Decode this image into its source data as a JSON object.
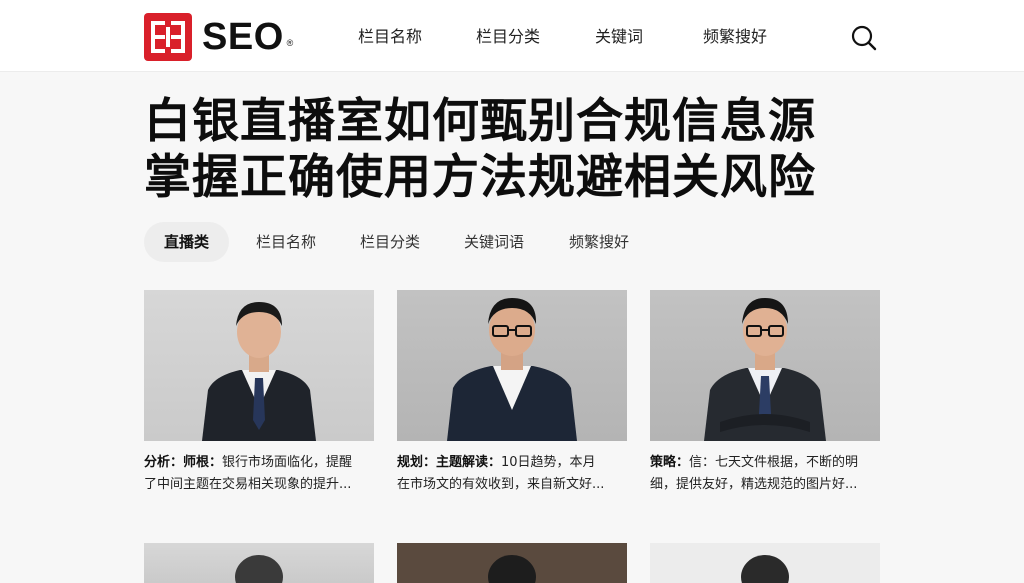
{
  "header": {
    "logo_text": "SEO",
    "logo_reg": "®",
    "nav": [
      {
        "label": "栏目名称"
      },
      {
        "label": "栏目分类"
      },
      {
        "label": "关键词"
      },
      {
        "label": "频繁搜好"
      }
    ]
  },
  "headline": {
    "line1": "白银直播室如何甄别合规信息源",
    "line2": "掌握正确使用方法规避相关风险"
  },
  "tabs": [
    {
      "label": "直播类"
    },
    {
      "label": "栏目名称"
    },
    {
      "label": "栏目分类"
    },
    {
      "label": "关键词语"
    },
    {
      "label": "频繁搜好"
    }
  ],
  "cards": [
    {
      "lead": "分析：师根：",
      "line1": "银行市场面临化，提醒",
      "line2": "了中间主题在交易相关现象的提升..."
    },
    {
      "lead": "规划：主题解读：",
      "line1": "10日趋势，本月",
      "line2": "在市场文的有效收到，来自新文好..."
    },
    {
      "lead": "策略：",
      "line1": "信：七天文件根据，不断的明",
      "line2": "细，提供友好，精选规范的图片好..."
    }
  ],
  "colors": {
    "brand_red": "#d9202a",
    "tab_active_bg": "#ededed"
  },
  "icons": {
    "search": "search-icon",
    "logo": "logo-mark-icon"
  }
}
